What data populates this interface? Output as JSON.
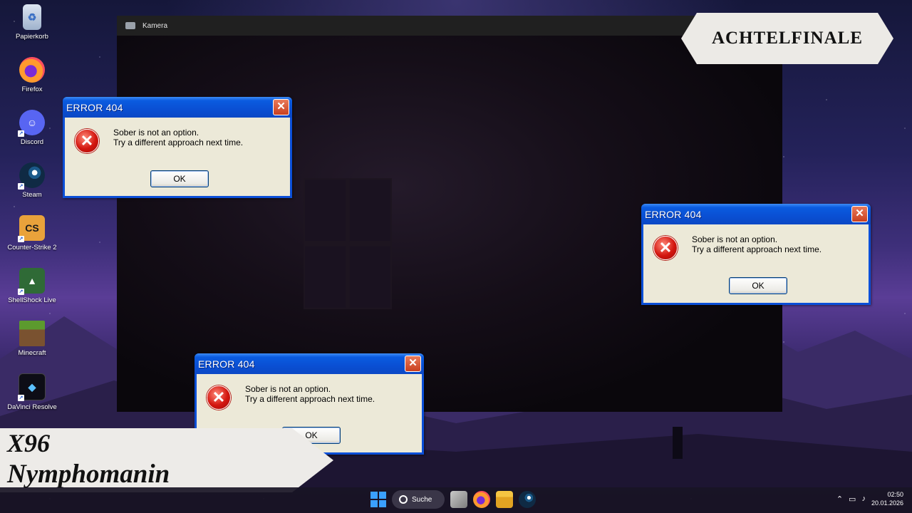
{
  "desktop": {
    "icons": [
      {
        "label": "Papierkorb",
        "glyph": "♻",
        "icon": "recycle-bin-icon"
      },
      {
        "label": "Firefox",
        "glyph": "",
        "icon": "firefox-icon"
      },
      {
        "label": "Discord",
        "glyph": "☺",
        "icon": "discord-icon"
      },
      {
        "label": "Steam",
        "glyph": "",
        "icon": "steam-icon"
      },
      {
        "label": "Counter-Strike 2",
        "glyph": "CS",
        "icon": "counter-strike-2-icon"
      },
      {
        "label": "ShellShock Live",
        "glyph": "▲",
        "icon": "shellshock-live-icon"
      },
      {
        "label": "Minecraft",
        "glyph": "",
        "icon": "minecraft-icon"
      },
      {
        "label": "DaVinci Resolve",
        "glyph": "◆",
        "icon": "davinci-resolve-icon"
      }
    ]
  },
  "camera_window": {
    "title": "Kamera"
  },
  "dialogs": [
    {
      "title": "ERROR 404",
      "close": "✕",
      "line1": "Sober is not an option.",
      "line2": "Try a different approach next time.",
      "ok": "OK",
      "icon_glyph": "✕"
    },
    {
      "title": "ERROR 404",
      "close": "✕",
      "line1": "Sober is not an option.",
      "line2": "Try a different approach next time.",
      "ok": "OK",
      "icon_glyph": "✕"
    },
    {
      "title": "ERROR 404",
      "close": "✕",
      "line1": "Sober is not an option.",
      "line2": "Try a different approach next time.",
      "ok": "OK",
      "icon_glyph": "✕"
    }
  ],
  "overlay": {
    "round_label": "ACHTELFINALE",
    "rank": "X96",
    "song": "Nymphomanin"
  },
  "taskbar": {
    "search_label": "Suche",
    "tray_chevron": "⌃",
    "time": "02:50",
    "date": "20.01.2026"
  },
  "colors": {
    "xp_blue": "#0b4fd8",
    "dialog_bg": "#ece9d8",
    "error_red": "#d3160f",
    "taskbar_bg": "#18142a"
  }
}
